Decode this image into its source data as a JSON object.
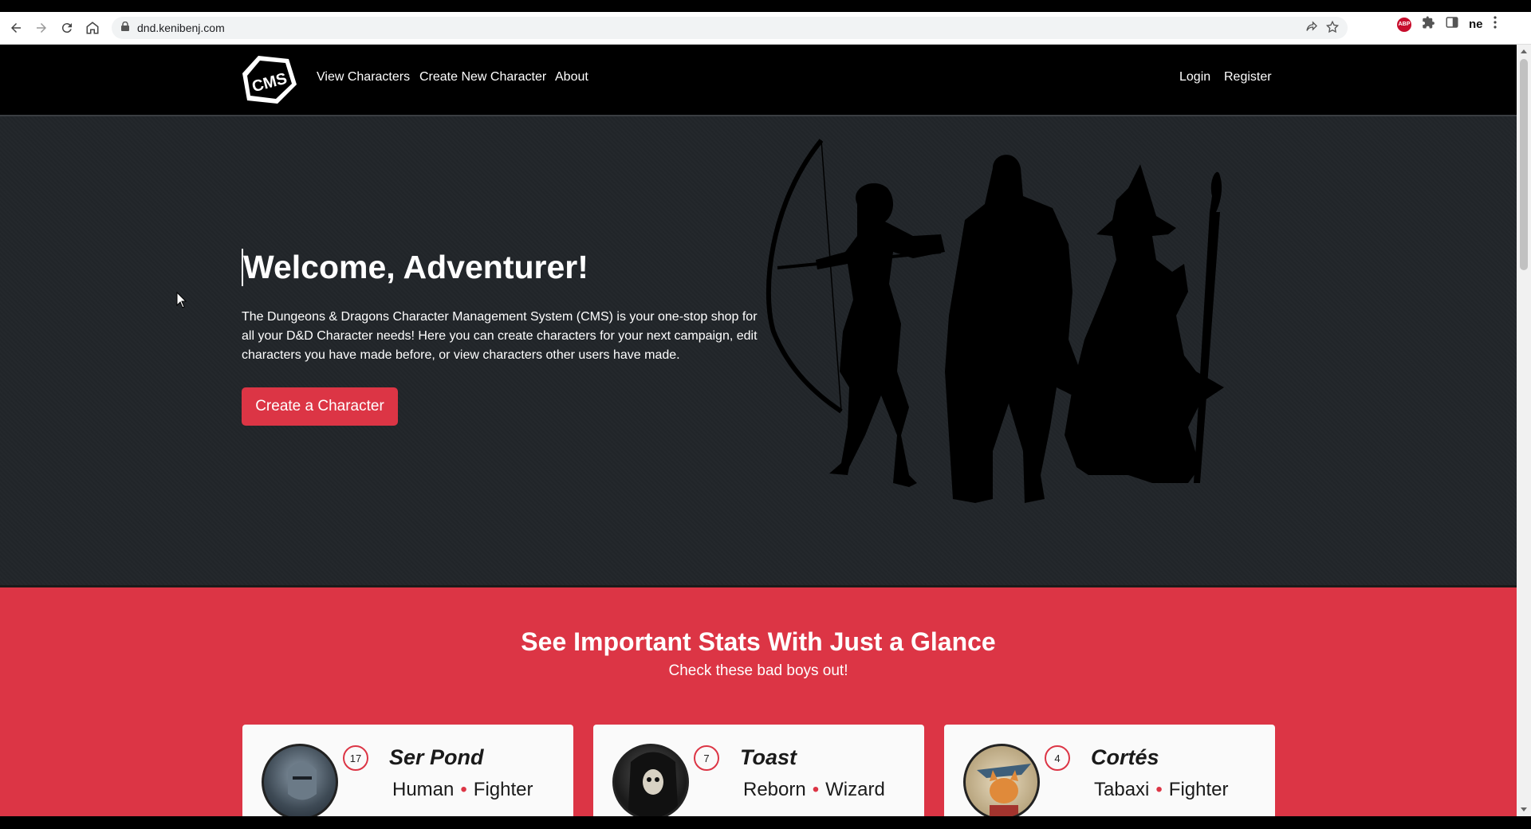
{
  "browser": {
    "url": "dnd.kenibenj.com",
    "profile_label": "ne",
    "abp_label": "ABP"
  },
  "nav": {
    "logo_text": "CMS",
    "links": [
      "View Characters",
      "Create New Character",
      "About"
    ],
    "login": "Login",
    "register": "Register"
  },
  "hero": {
    "title": "Welcome, Adventurer!",
    "description": "The Dungeons & Dragons Character Management System (CMS) is your one-stop shop for all your D&D Character needs! Here you can create characters for your next campaign, edit characters you have made before, or view characters other users have made.",
    "cta_label": "Create a Character"
  },
  "stats_section": {
    "title": "See Important Stats With Just a Glance",
    "subtitle": "Check these bad boys out!",
    "cards": [
      {
        "name": "Ser Pond",
        "level": "17",
        "race": "Human",
        "class": "Fighter"
      },
      {
        "name": "Toast",
        "level": "7",
        "race": "Reborn",
        "class": "Wizard"
      },
      {
        "name": "Cortés",
        "level": "4",
        "race": "Tabaxi",
        "class": "Fighter"
      }
    ]
  },
  "colors": {
    "accent": "#dc3545",
    "hero_bg": "#212529",
    "nav_bg": "#000000"
  }
}
